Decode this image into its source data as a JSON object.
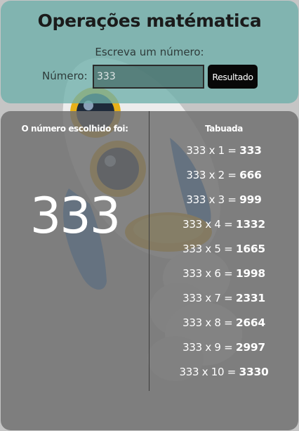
{
  "header": {
    "title": "Operações matématica",
    "prompt": "Escreva um número:",
    "number_label": "Número:",
    "input_value": "333",
    "button_label": "Resultado"
  },
  "left": {
    "heading": "O número escolhido foi:",
    "chosen_number": "333"
  },
  "right": {
    "heading": "Tabuada",
    "rows": [
      {
        "expr": "333 x 1 =",
        "result": "333"
      },
      {
        "expr": "333 x 2 =",
        "result": "666"
      },
      {
        "expr": "333 x 3 =",
        "result": "999"
      },
      {
        "expr": "333 x 4 =",
        "result": "1332"
      },
      {
        "expr": "333 x 5 =",
        "result": "1665"
      },
      {
        "expr": "333 x 6 =",
        "result": "1998"
      },
      {
        "expr": "333 x 7 =",
        "result": "2331"
      },
      {
        "expr": "333 x 8 =",
        "result": "2664"
      },
      {
        "expr": "333 x 9 =",
        "result": "2997"
      },
      {
        "expr": "333 x 10 =",
        "result": "3330"
      }
    ]
  },
  "colors": {
    "top_panel": "#6eb0aa",
    "main_panel": "#707070",
    "button": "#080808",
    "rocket_blue": "#2f7fd0",
    "rocket_gold": "#e8b019"
  },
  "icons": {
    "background": "rocket-illustration"
  }
}
